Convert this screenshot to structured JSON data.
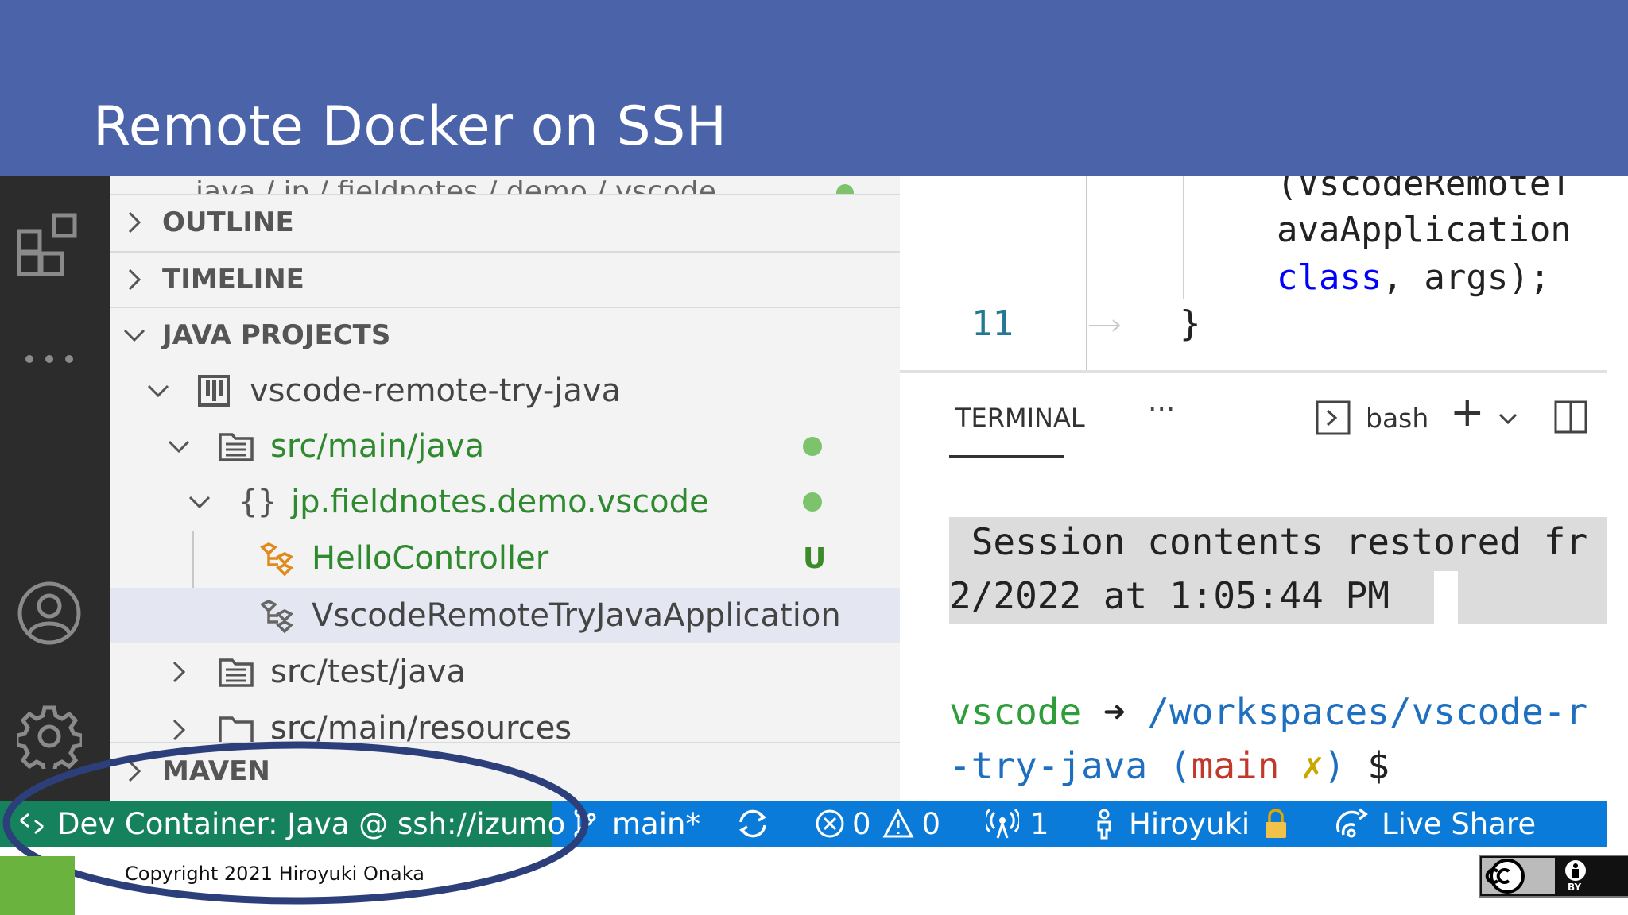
{
  "slide": {
    "title": "Remote Docker on SSH"
  },
  "sidebar": {
    "partial_path": "java / jp / fieldnotes / demo / vscode",
    "sections": {
      "outline": "OUTLINE",
      "timeline": "TIMELINE",
      "java_projects": "JAVA PROJECTS",
      "maven": "MAVEN"
    },
    "project": "vscode-remote-try-java",
    "src_main_java": "src/main/java",
    "package": "jp.fieldnotes.demo.vscode",
    "hello_controller": "HelloController",
    "hello_badge": "U",
    "application": "VscodeRemoteTryJavaApplication",
    "src_test_java": "src/test/java",
    "src_main_resources": "src/main/resources"
  },
  "editor": {
    "line1": "(VscodeRemoteT",
    "line2": "avaApplication",
    "line3_kw": "class",
    "line3_rest": ", args);",
    "line_number": "11",
    "brace": "}"
  },
  "panel": {
    "tab": "TERMINAL",
    "more": "···",
    "shell": "bash",
    "add": "+",
    "session_line1": " Session contents restored fr",
    "session_line2": "2/2022 at 1:05:44 PM ",
    "prompt_user": "vscode",
    "prompt_arrow": " ➜ ",
    "prompt_path1": "/workspaces/vscode-r",
    "prompt_path2": "-try-java",
    "prompt_branch_open": " (",
    "prompt_branch": "main",
    "prompt_dirty": " ✗",
    "prompt_branch_close": ")",
    "prompt_dollar": " $"
  },
  "statusbar": {
    "remote": "Dev Container: Java @ ssh://izumo",
    "branch": "main*",
    "errors": "0",
    "warnings": "0",
    "ports": "1",
    "user": "Hiroyuki",
    "live_share": "Live Share"
  },
  "footer": {
    "copyright": "Copyright 2021 Hiroyuki Onaka",
    "license_by": "BY"
  },
  "colors": {
    "header": "#4a63a9",
    "status_bar": "#0a7bd8",
    "remote": "#16825d",
    "annotation": "#2c3f7a",
    "green_text": "#2f8a2f"
  }
}
